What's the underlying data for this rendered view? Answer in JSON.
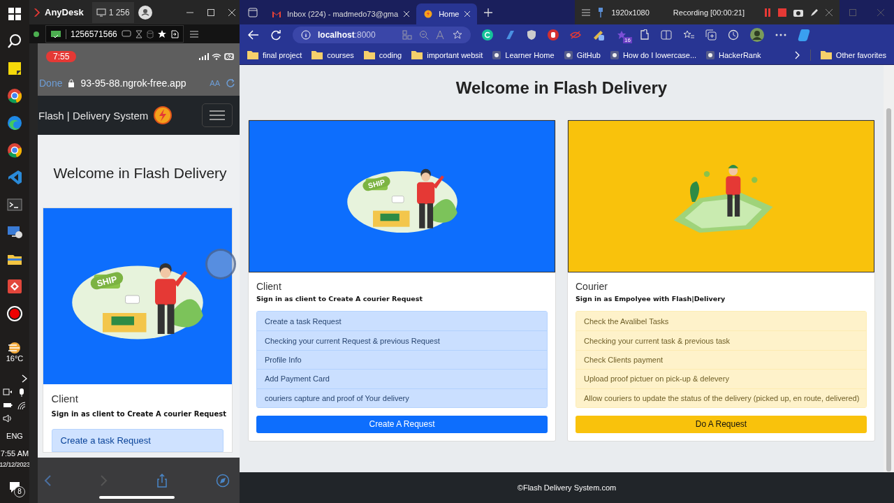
{
  "taskbar": {
    "weather": "16°C",
    "language": "ENG",
    "time": "7:55 AM",
    "date": "12/12/2023",
    "notification_count": "8"
  },
  "anydesk": {
    "title": "AnyDesk",
    "session_tab": "1 256",
    "address": "1256571566",
    "phone": {
      "clock": "7:55",
      "battery": "62",
      "done": "Done",
      "url": "93-95-88.ngrok-free.app",
      "text_size": "AA",
      "brand": "Flash | Delivery System",
      "heading": "Welcome in Flash Delivery",
      "card": {
        "kind": "parcel",
        "color": "#0d6efd",
        "illustration_text": "SHIP",
        "title": "Client",
        "subtitle": "Sign in as client to Create A courier Request",
        "items": [
          "Create a task Request"
        ]
      }
    }
  },
  "recorder": {
    "resolution": "1920x1080",
    "status": "Recording [00:00:21]"
  },
  "browser": {
    "tabs": [
      {
        "label": "Inbox (224) - madmedo73@gma",
        "selected": false
      },
      {
        "label": "Home",
        "selected": true
      }
    ],
    "address": "**localhost**:8000",
    "extension_badge": "16",
    "bookmarks": [
      {
        "label": "final project",
        "kind": "folder"
      },
      {
        "label": "courses",
        "kind": "folder"
      },
      {
        "label": "coding",
        "kind": "folder"
      },
      {
        "label": "important websit",
        "kind": "folder"
      },
      {
        "label": "Learner Home",
        "kind": "site"
      },
      {
        "label": "GitHub",
        "kind": "site"
      },
      {
        "label": "How do I lowercase...",
        "kind": "site"
      },
      {
        "label": "HackerRank",
        "kind": "site"
      }
    ],
    "other_bookmarks": "Other favorites"
  },
  "page": {
    "heading": "Welcome in Flash Delivery",
    "cards": [
      {
        "kind": "parcel",
        "color": "#0d6efd",
        "illustration_text": "SHIP",
        "title": "Client",
        "subtitle": "Sign in as client to Create A courier Request",
        "items": [
          "Create a task Request",
          "Checking your current Request & previous Request",
          "Profile Info",
          "Add Payment Card",
          "couriers capture and proof of Your delivery"
        ],
        "button": "Create A Request"
      },
      {
        "kind": "map",
        "color": "#f9c20c",
        "title": "Courier",
        "subtitle": "Sign in as Empolyee with Flash|Delivery",
        "items": [
          "Check the Avalibel Tasks",
          "Checking your current task & previous task",
          "Check Clients payment",
          "Upload proof pictuer on pick-up & delevery",
          "Allow couriers to update the status of the delivery (picked up, en route, delivered)"
        ],
        "button": "Do A Request"
      }
    ],
    "footer": "©Flash Delivery System.com"
  }
}
